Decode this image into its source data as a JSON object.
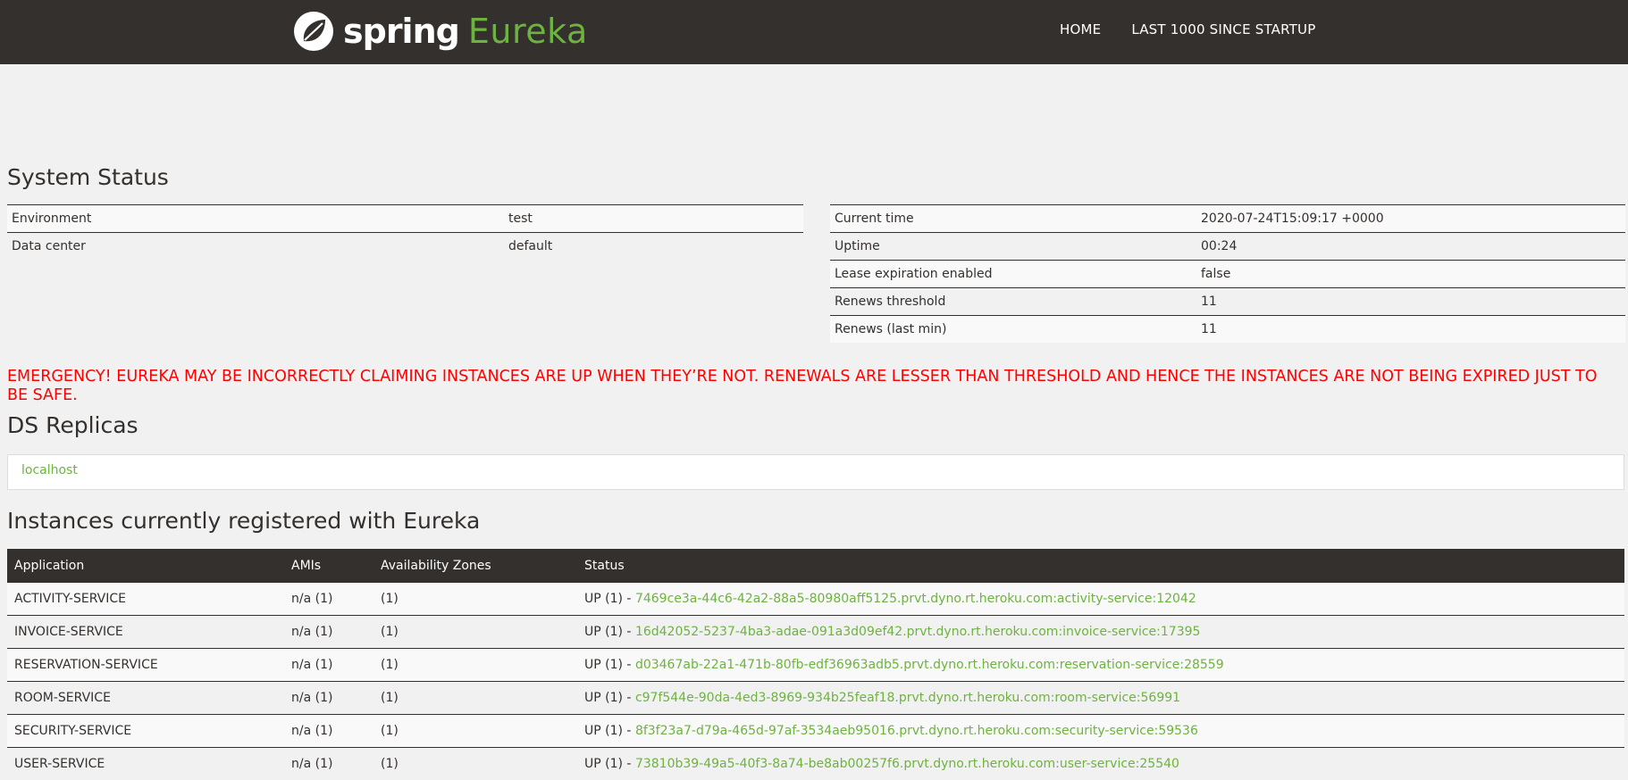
{
  "header": {
    "brand_spring": "spring",
    "brand_eureka": "Eureka",
    "nav": [
      "HOME",
      "LAST 1000 SINCE STARTUP"
    ]
  },
  "system_status": {
    "title": "System Status",
    "left": [
      {
        "key": "Environment",
        "value": "test"
      },
      {
        "key": "Data center",
        "value": "default"
      }
    ],
    "right": [
      {
        "key": "Current time",
        "value": "2020-07-24T15:09:17 +0000"
      },
      {
        "key": "Uptime",
        "value": "00:24"
      },
      {
        "key": "Lease expiration enabled",
        "value": "false"
      },
      {
        "key": "Renews threshold",
        "value": "11"
      },
      {
        "key": "Renews (last min)",
        "value": "11"
      }
    ]
  },
  "emergency": "EMERGENCY! EUREKA MAY BE INCORRECTLY CLAIMING INSTANCES ARE UP WHEN THEY’RE NOT. RENEWALS ARE LESSER THAN THRESHOLD AND HENCE THE INSTANCES ARE NOT BEING EXPIRED JUST TO BE SAFE.",
  "ds_replicas": {
    "title": "DS Replicas",
    "items": [
      "localhost"
    ]
  },
  "instances": {
    "title": "Instances currently registered with Eureka",
    "headers": [
      "Application",
      "AMIs",
      "Availability Zones",
      "Status"
    ],
    "rows": [
      {
        "app": "ACTIVITY-SERVICE",
        "amis": "n/a (1)",
        "zones": "(1)",
        "status_prefix": "UP (1) - ",
        "instance": "7469ce3a-44c6-42a2-88a5-80980aff5125.prvt.dyno.rt.heroku.com:activity-service:12042"
      },
      {
        "app": "INVOICE-SERVICE",
        "amis": "n/a (1)",
        "zones": "(1)",
        "status_prefix": "UP (1) - ",
        "instance": "16d42052-5237-4ba3-adae-091a3d09ef42.prvt.dyno.rt.heroku.com:invoice-service:17395"
      },
      {
        "app": "RESERVATION-SERVICE",
        "amis": "n/a (1)",
        "zones": "(1)",
        "status_prefix": "UP (1) - ",
        "instance": "d03467ab-22a1-471b-80fb-edf36963adb5.prvt.dyno.rt.heroku.com:reservation-service:28559"
      },
      {
        "app": "ROOM-SERVICE",
        "amis": "n/a (1)",
        "zones": "(1)",
        "status_prefix": "UP (1) - ",
        "instance": "c97f544e-90da-4ed3-8969-934b25feaf18.prvt.dyno.rt.heroku.com:room-service:56991"
      },
      {
        "app": "SECURITY-SERVICE",
        "amis": "n/a (1)",
        "zones": "(1)",
        "status_prefix": "UP (1) - ",
        "instance": "8f3f23a7-d79a-465d-97af-3534aeb95016.prvt.dyno.rt.heroku.com:security-service:59536"
      },
      {
        "app": "USER-SERVICE",
        "amis": "n/a (1)",
        "zones": "(1)",
        "status_prefix": "UP (1) - ",
        "instance": "73810b39-49a5-40f3-8a74-be8ab00257f6.prvt.dyno.rt.heroku.com:user-service:25540"
      }
    ]
  },
  "colors": {
    "header_bg": "#34302d",
    "accent_green": "#6db33f",
    "emergency_red": "#ff0000",
    "page_bg": "#f1f1f1"
  },
  "icons": {
    "logo": "spring-leaf-icon"
  }
}
